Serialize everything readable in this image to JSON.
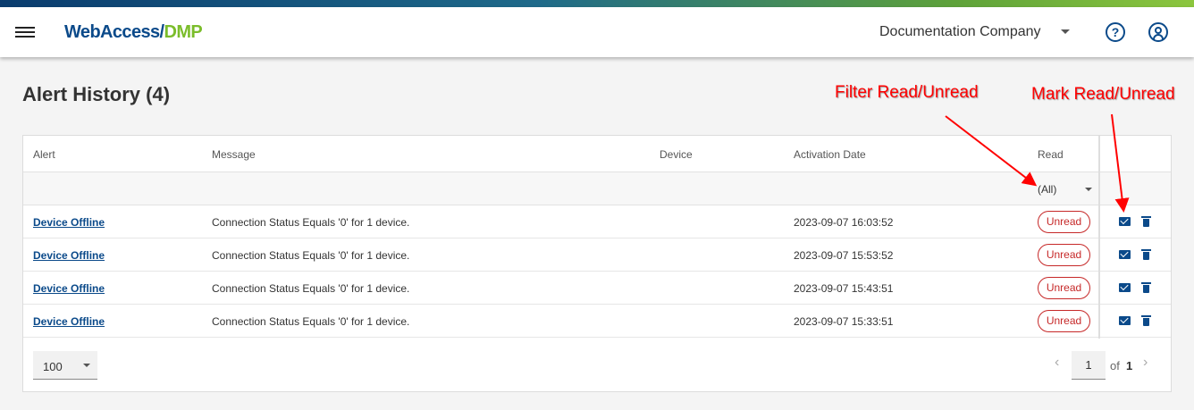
{
  "header": {
    "brand_part1": "WebAccess/",
    "brand_part2": "DMP",
    "company": "Documentation Company",
    "help_icon": "?"
  },
  "page": {
    "title": "Alert History (4)"
  },
  "table": {
    "columns": [
      "Alert",
      "Message",
      "Device",
      "Activation Date",
      "Read"
    ],
    "read_filter": "(All)",
    "rows": [
      {
        "alert": "Device Offline",
        "message": "Connection Status Equals '0' for 1 device.",
        "device": "",
        "activation_date": "2023-09-07 16:03:52",
        "read": "Unread"
      },
      {
        "alert": "Device Offline",
        "message": "Connection Status Equals '0' for 1 device.",
        "device": "",
        "activation_date": "2023-09-07 15:53:52",
        "read": "Unread"
      },
      {
        "alert": "Device Offline",
        "message": "Connection Status Equals '0' for 1 device.",
        "device": "",
        "activation_date": "2023-09-07 15:43:51",
        "read": "Unread"
      },
      {
        "alert": "Device Offline",
        "message": "Connection Status Equals '0' for 1 device.",
        "device": "",
        "activation_date": "2023-09-07 15:33:51",
        "read": "Unread"
      }
    ]
  },
  "pager": {
    "page_size": "100",
    "current_page": "1",
    "of_label": "of",
    "total_pages": "1"
  },
  "annotations": {
    "filter": "Filter Read/Unread",
    "mark": "Mark Read/Unread"
  },
  "colors": {
    "brand_blue": "#0b4a8a",
    "brand_green": "#7bbd2b",
    "unread_red": "#c62828",
    "annotation_red": "#ff0000"
  }
}
